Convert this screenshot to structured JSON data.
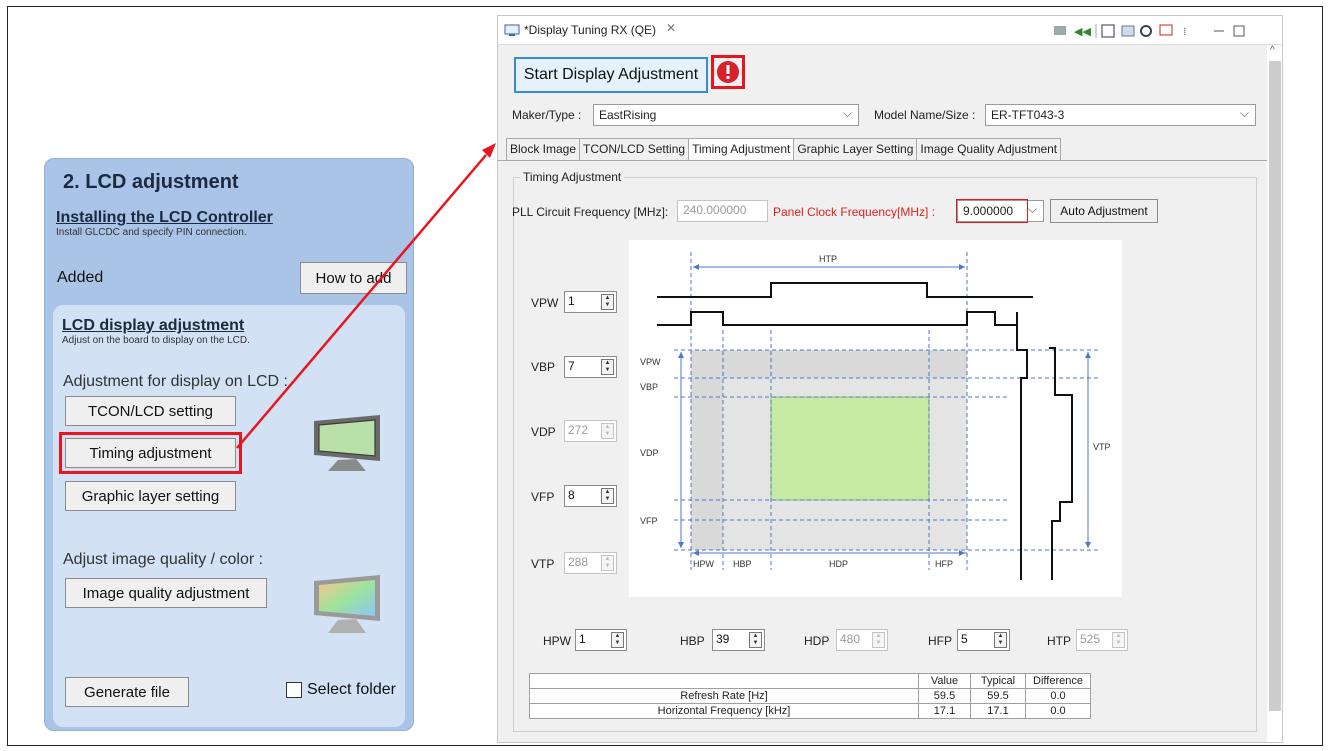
{
  "guide": {
    "title": "2. LCD adjustment",
    "installing_link": "Installing the LCD Controller",
    "installing_desc": "Install GLCDC and specify PIN connection.",
    "status": "Added",
    "how_to_add": "How to add",
    "display_link": "LCD display adjustment",
    "display_desc": "Adjust on the board to display on the LCD.",
    "adjust_label": "Adjustment for display on LCD :",
    "tcon_button": "TCON/LCD setting",
    "timing_button": "Timing adjustment",
    "graphic_button": "Graphic layer setting",
    "quality_label": "Adjust image quality / color :",
    "quality_button": "Image quality adjustment",
    "generate_button": "Generate file",
    "select_folder": "Select folder"
  },
  "window": {
    "tab_title": "*Display Tuning RX (QE)",
    "start_button": "Start Display Adjustment",
    "maker_label": "Maker/Type :",
    "maker_value": "EastRising",
    "model_label": "Model Name/Size :",
    "model_value": "ER-TFT043-3",
    "tabs": [
      "Block Image",
      "TCON/LCD Setting",
      "Timing Adjustment",
      "Graphic Layer Setting",
      "Image Quality Adjustment"
    ],
    "active_tab": "Timing Adjustment",
    "group_title": "Timing Adjustment",
    "pll_label": "PLL Circuit Frequency [MHz]:",
    "pll_value": "240.000000",
    "panel_clock_label": "Panel Clock Frequency[MHz] :",
    "panel_clock_value": "9.000000",
    "auto_button": "Auto Adjustment"
  },
  "vertical": {
    "vpw": {
      "label": "VPW",
      "value": "1"
    },
    "vbp": {
      "label": "VBP",
      "value": "7"
    },
    "vdp": {
      "label": "VDP",
      "value": "272"
    },
    "vfp": {
      "label": "VFP",
      "value": "8"
    },
    "vtp": {
      "label": "VTP",
      "value": "288"
    }
  },
  "horizontal": {
    "hpw": {
      "label": "HPW",
      "value": "1"
    },
    "hbp": {
      "label": "HBP",
      "value": "39"
    },
    "hdp": {
      "label": "HDP",
      "value": "480"
    },
    "hfp": {
      "label": "HFP",
      "value": "5"
    },
    "htp": {
      "label": "HTP",
      "value": "525"
    }
  },
  "diagram": {
    "htp": "HTP",
    "vtp": "VTP",
    "vpw": "VPW",
    "vbp": "VBP",
    "vdp": "VDP",
    "vfp": "VFP",
    "hpw": "HPW",
    "hbp": "HBP",
    "hdp": "HDP",
    "hfp": "HFP"
  },
  "results": {
    "headers": [
      "",
      "Value",
      "Typical",
      "Difference"
    ],
    "rows": [
      {
        "name": "Refresh Rate [Hz]",
        "value": "59.5",
        "typical": "59.5",
        "diff": "0.0"
      },
      {
        "name": "Horizontal Frequency [kHz]",
        "value": "17.1",
        "typical": "17.1",
        "diff": "0.0"
      }
    ]
  },
  "colors": {
    "highlight": "#e8141e",
    "panel": "#a9c4e6",
    "active_area": "#c6eaa3"
  }
}
